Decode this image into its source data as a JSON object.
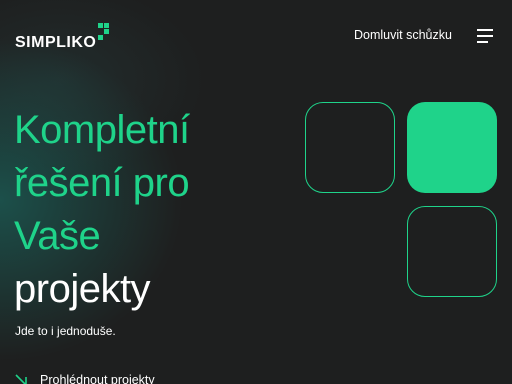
{
  "brand": {
    "name": "SIMPLIKO",
    "accent_color": "#1fd38a"
  },
  "header": {
    "nav_link": "Domluvit schůzku",
    "menu_icon": "hamburger-menu-icon"
  },
  "hero": {
    "title_lines_green": [
      "Kompletní",
      "řešení pro",
      "Vaše"
    ],
    "title_line_white": "projekty",
    "subtitle": "Jde to i jednoduše.",
    "cta_label": "Prohlédnout projekty",
    "cta_icon": "arrow-down-right-icon"
  },
  "decoration": {
    "tiles": [
      "outline",
      "filled",
      "outline"
    ]
  }
}
